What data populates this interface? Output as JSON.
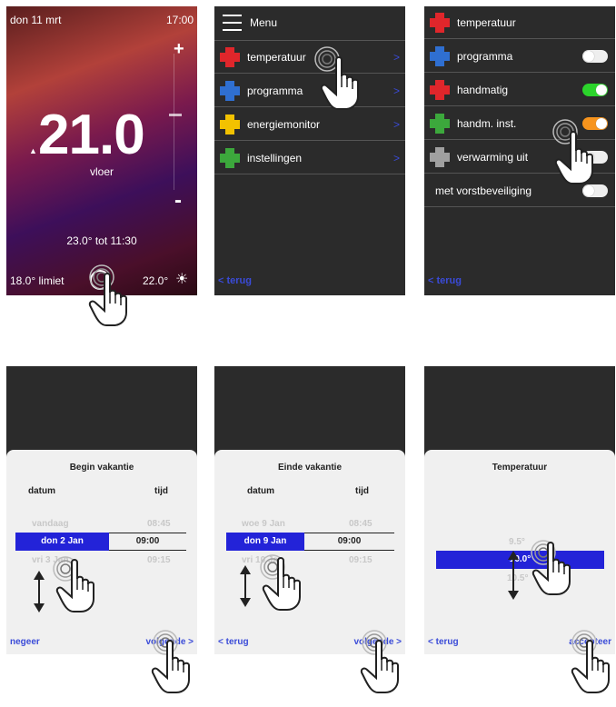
{
  "home": {
    "date": "don 11 mrt",
    "time": "17:00",
    "plus": "+",
    "minus": "-",
    "temp": "21.0",
    "zone": "vloer",
    "until": "23.0° tot 11:30",
    "limit": "18.0° limiet",
    "outside": "22.0°"
  },
  "menu": {
    "title": "Menu",
    "items": [
      {
        "label": "temperatuur",
        "color": "#e0262b"
      },
      {
        "label": "programma",
        "color": "#2f6fd1"
      },
      {
        "label": "energiemonitor",
        "color": "#f2c200"
      },
      {
        "label": "instellingen",
        "color": "#3ca83c"
      }
    ],
    "back": "< terug"
  },
  "settings": {
    "items": [
      {
        "label": "temperatuur",
        "color": "#e0262b",
        "toggle": null
      },
      {
        "label": "programma",
        "color": "#2f6fd1",
        "toggle": "off"
      },
      {
        "label": "handmatig",
        "color": "#e0262b",
        "toggle": "on-green"
      },
      {
        "label": "handm. inst.",
        "color": "#3ca83c",
        "toggle": "on-orange"
      },
      {
        "label": "verwarming uit",
        "color": "#a0a0a0",
        "toggle": "off"
      },
      {
        "label": "met vorstbeveiliging",
        "color": null,
        "toggle": "off"
      }
    ],
    "back": "< terug"
  },
  "begin": {
    "title": "Begin vakantie",
    "col1": "datum",
    "col2": "tijd",
    "prev_date": "vandaag",
    "prev_time": "08:45",
    "sel_date": "don 2 Jan",
    "sel_time": "09:00",
    "next_date": "vri 3 Jan",
    "next_time": "09:15",
    "left": "negeer",
    "right": "volgende >"
  },
  "end": {
    "title": "Einde vakantie",
    "col1": "datum",
    "col2": "tijd",
    "prev_date": "woe 9 Jan",
    "prev_time": "08:45",
    "sel_date": "don 9 Jan",
    "sel_time": "09:00",
    "next_date": "vri 10 Jan",
    "next_time": "09:15",
    "left": "< terug",
    "right": "volgende >"
  },
  "temp": {
    "title": "Temperatuur",
    "prev": "9.5°",
    "sel": "10.0°",
    "next": "10.5°",
    "left": "< terug",
    "right": "accepteer"
  },
  "colors": {
    "accent": "#3a4bd8",
    "green": "#2bd42b",
    "orange": "#f7941d"
  }
}
